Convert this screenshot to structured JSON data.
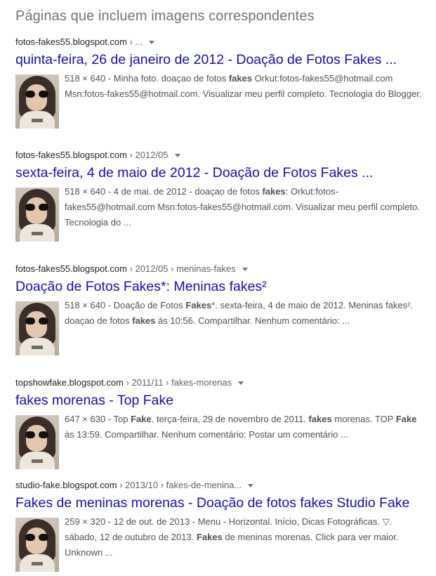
{
  "heading": "Páginas que incluem imagens correspondentes",
  "results": [
    {
      "domain": "fotos-fakes55.blogspot.com",
      "path": " › ...",
      "title": "quinta-feira, 26 de janeiro de 2012 - Doação de Fotos Fakes ...",
      "snippet": [
        {
          "t": "518 × 640 - Minha foto. doaçao de fotos ",
          "b": false
        },
        {
          "t": "fakes",
          "b": true
        },
        {
          "t": " Orkut:fotos-fakes55@hotmail.com Msn:fotos-fakes55@hotmail.com. Visualizar meu perfil completo. Tecnologia do Blogger.",
          "b": false
        }
      ]
    },
    {
      "domain": "fotos-fakes55.blogspot.com",
      "path": " › 2012/05",
      "title": "sexta-feira, 4 de maio de 2012 - Doação de Fotos Fakes ...",
      "snippet": [
        {
          "t": "518 × 640 - 4 de mai. de 2012 - doaçao de fotos ",
          "b": false
        },
        {
          "t": "fakes",
          "b": true
        },
        {
          "t": ": Orkut:fotos-fakes55@hotmail.com Msn:fotos-fakes55@hotmail.com. Visualizar meu perfil completo. Tecnologia do ...",
          "b": false
        }
      ]
    },
    {
      "domain": "fotos-fakes55.blogspot.com",
      "path": " › 2012/05 › meninas-fakes",
      "title": "Doação de Fotos Fakes*: Meninas fakes²",
      "snippet": [
        {
          "t": "518 × 640 - Doação de Fotos ",
          "b": false
        },
        {
          "t": "Fakes",
          "b": true
        },
        {
          "t": "*. sexta-feira, 4 de maio de 2012. Meninas fakes². doaçao de fotos ",
          "b": false
        },
        {
          "t": "fakes",
          "b": true
        },
        {
          "t": " às 10:56. Compartilhar. Nenhum comentário: ...",
          "b": false
        }
      ]
    },
    {
      "domain": "topshowfake.blogspot.com",
      "path": " › 2011/11 › fakes-morenas",
      "title": "fakes morenas - Top Fake",
      "snippet": [
        {
          "t": "647 × 630 - Top ",
          "b": false
        },
        {
          "t": "Fake",
          "b": true
        },
        {
          "t": ". terça-feira, 29 de novembro de 2011. ",
          "b": false
        },
        {
          "t": "fakes",
          "b": true
        },
        {
          "t": " morenas. TOP ",
          "b": false
        },
        {
          "t": "Fake",
          "b": true
        },
        {
          "t": " às 13:59. Compartilhar. Nenhum comentário: Postar um comentário ...",
          "b": false
        }
      ]
    },
    {
      "domain": "studio-fake.blogspot.com",
      "path": " › 2013/10 › fakes-de-menina...",
      "title": "Fakes de meninas morenas - Doação de fotos fakes Studio Fake",
      "snippet": [
        {
          "t": "259 × 320 - 12 de out. de 2013 - Menu - Horizontal. Início, Dicas Fotográficas. ▽. sábado, 12 de outubro de 2013. ",
          "b": false
        },
        {
          "t": "Fakes",
          "b": true
        },
        {
          "t": " de meninas morenas. Click para ver maior. Unknown ...",
          "b": false
        }
      ]
    }
  ]
}
